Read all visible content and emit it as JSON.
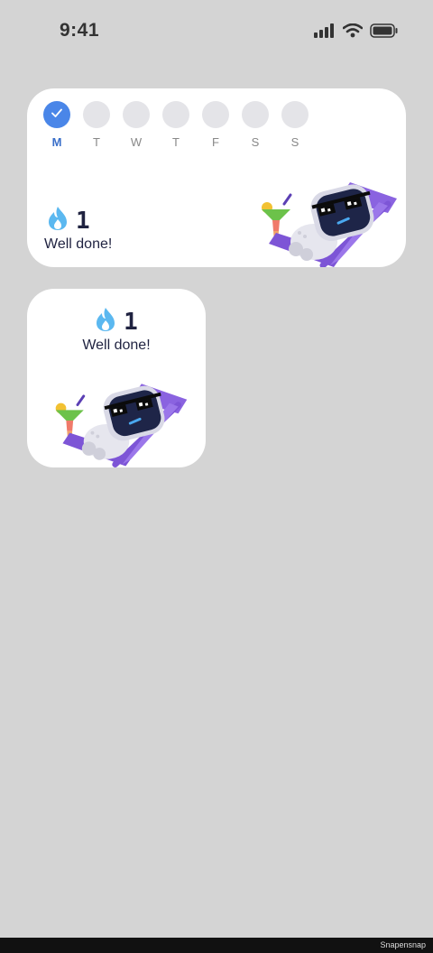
{
  "status_bar": {
    "time": "9:41",
    "icons": [
      "cellular-signal-icon",
      "wifi-icon",
      "battery-icon"
    ]
  },
  "colors": {
    "background": "#d4d4d4",
    "accent": "#4a86e8",
    "flame": "#5bb8f0",
    "chair": "#7d55d6"
  },
  "medium_widget": {
    "days": [
      {
        "label": "M",
        "done": true
      },
      {
        "label": "T",
        "done": false
      },
      {
        "label": "W",
        "done": false
      },
      {
        "label": "T",
        "done": false
      },
      {
        "label": "F",
        "done": false
      },
      {
        "label": "S",
        "done": false
      },
      {
        "label": "S",
        "done": false
      }
    ],
    "streak_count": "1",
    "message": "Well done!",
    "illustration": "robot-lounging-icon"
  },
  "small_widget": {
    "streak_count": "1",
    "message": "Well done!",
    "illustration": "robot-lounging-icon"
  },
  "footer": {
    "watermark": "Snapensnap"
  }
}
